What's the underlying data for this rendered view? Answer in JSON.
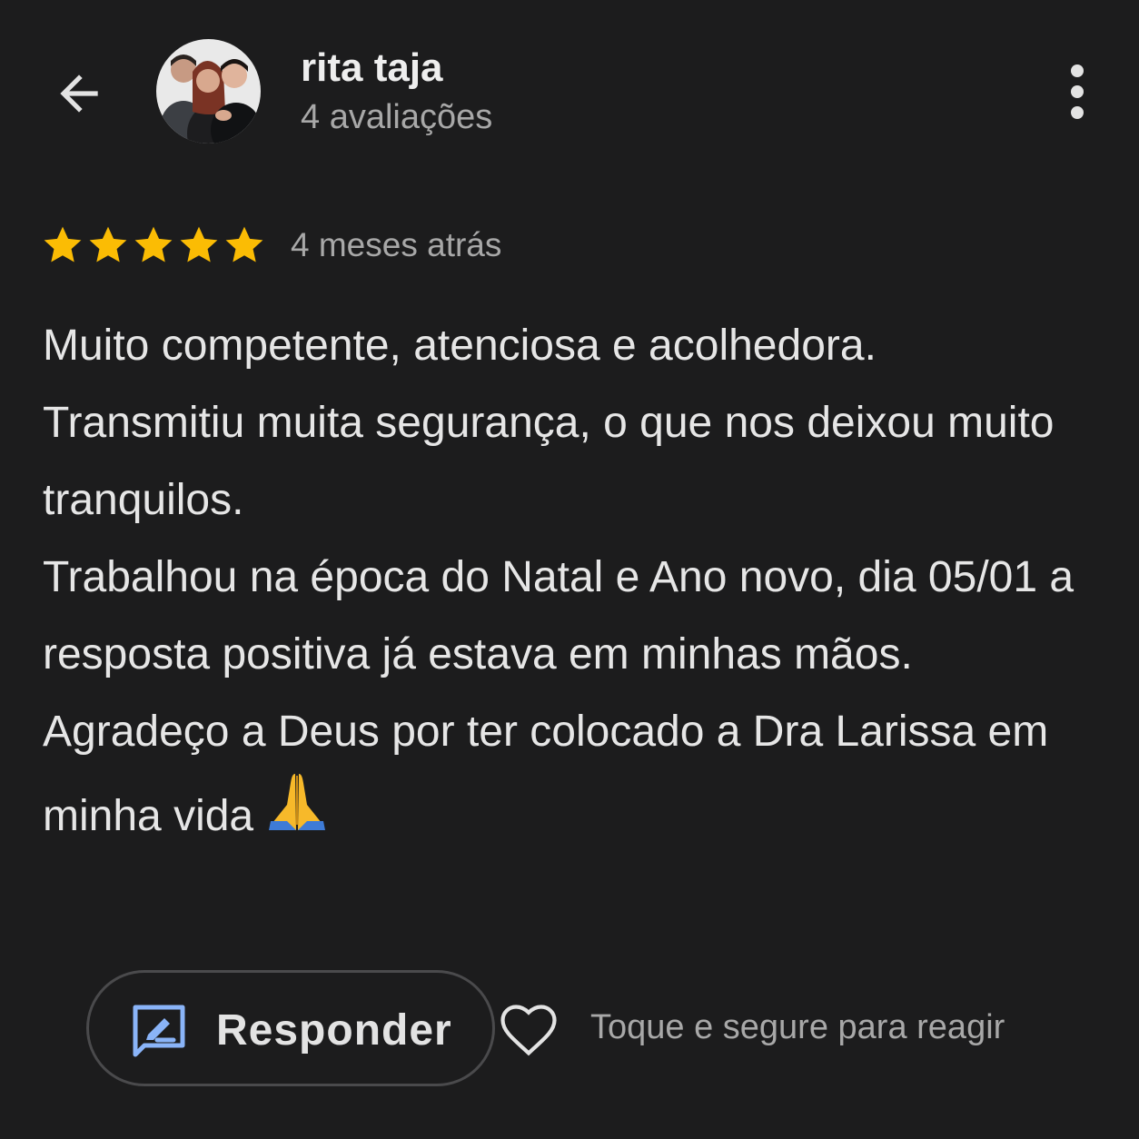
{
  "header": {
    "user_name": "rita taja",
    "review_count": "4 avaliações",
    "back_icon": "arrow-back-icon",
    "more_icon": "more-vertical-icon"
  },
  "review": {
    "rating": 5,
    "rating_max": 5,
    "time_ago": "4 meses atrás",
    "text": "Muito competente, atenciosa e acolhedora.\nTransmitiu muita segurança, o que nos deixou muito tranquilos.\nTrabalhou na época do Natal e Ano novo, dia 05/01 a resposta positiva já estava em minhas mãos.\nAgradeço a Deus por ter colocado a Dra Larissa em minha vida",
    "emoji": "🙏"
  },
  "actions": {
    "reply_label": "Responder",
    "reply_icon": "reply-edit-icon",
    "heart_icon": "heart-outline-icon",
    "react_hint": "Toque e segure para reagir"
  },
  "colors": {
    "background": "#1c1c1d",
    "star": "#fbbc04",
    "text_primary": "#e6e6e6",
    "text_secondary": "#a8a8a8",
    "reply_icon": "#8ab4f8"
  }
}
